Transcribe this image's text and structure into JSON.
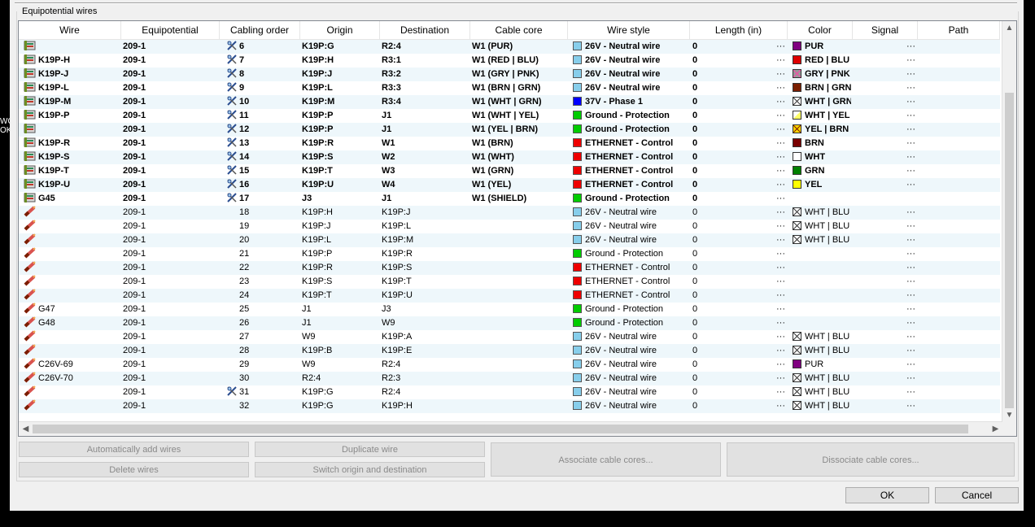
{
  "window": {
    "group_title": "Equipotential wires"
  },
  "columns": [
    {
      "key": "wire",
      "label": "Wire"
    },
    {
      "key": "equip",
      "label": "Equipotential"
    },
    {
      "key": "order",
      "label": "Cabling order"
    },
    {
      "key": "origin",
      "label": "Origin"
    },
    {
      "key": "dest",
      "label": "Destination"
    },
    {
      "key": "core",
      "label": "Cable core"
    },
    {
      "key": "style",
      "label": "Wire style"
    },
    {
      "key": "length",
      "label": "Length (in)"
    },
    {
      "key": "color",
      "label": "Color"
    },
    {
      "key": "signal",
      "label": "Signal"
    },
    {
      "key": "path",
      "label": "Path"
    }
  ],
  "style_colors": {
    "26V - Neutral wire": "#87ceeb",
    "37V - Phase 1": "#0000ff",
    "Ground - Protection": "#00cc00",
    "ETHERNET - Control": "#ee0000"
  },
  "rows": [
    {
      "bold": true,
      "icon": "cable-icon",
      "wire": "",
      "equip": "209-1",
      "oicon": true,
      "order": "6",
      "origin": "K19P:G",
      "dest": "R2:4",
      "core": "W1 (PUR)",
      "style": "26V - Neutral wire",
      "length": "0",
      "dots": "···",
      "color": "PUR",
      "swatch": "#800080",
      "signal": "···",
      "path": ""
    },
    {
      "bold": true,
      "icon": "cable-icon",
      "wire": "K19P-H",
      "equip": "209-1",
      "oicon": true,
      "order": "7",
      "origin": "K19P:H",
      "dest": "R3:1",
      "core": "W1 (RED  |  BLU)",
      "style": "26V - Neutral wire",
      "length": "0",
      "dots": "···",
      "color": "RED  |  BLU",
      "swatch": "#dd0000",
      "signal": "···",
      "path": ""
    },
    {
      "bold": true,
      "icon": "cable-icon",
      "wire": "K19P-J",
      "equip": "209-1",
      "oicon": true,
      "order": "8",
      "origin": "K19P:J",
      "dest": "R3:2",
      "core": "W1 (GRY  |  PNK)",
      "style": "26V - Neutral wire",
      "length": "0",
      "dots": "···",
      "color": "GRY  |  PNK",
      "swatch": "pattern-gray",
      "signal": "···",
      "path": ""
    },
    {
      "bold": true,
      "icon": "cable-icon",
      "wire": "K19P-L",
      "equip": "209-1",
      "oicon": true,
      "order": "9",
      "origin": "K19P:L",
      "dest": "R3:3",
      "core": "W1 (BRN  |  GRN)",
      "style": "26V - Neutral wire",
      "length": "0",
      "dots": "···",
      "color": "BRN  |  GRN",
      "swatch": "#7a1e00",
      "signal": "···",
      "path": ""
    },
    {
      "bold": true,
      "icon": "cable-icon",
      "wire": "K19P-M",
      "equip": "209-1",
      "oicon": true,
      "order": "10",
      "origin": "K19P:M",
      "dest": "R3:4",
      "core": "W1 (WHT  |  GRN)",
      "style": "37V - Phase 1",
      "length": "0",
      "dots": "···",
      "color": "WHT  |  GRN",
      "swatch": "pattern-x",
      "signal": "···",
      "path": ""
    },
    {
      "bold": true,
      "icon": "cable-icon",
      "wire": "K19P-P",
      "equip": "209-1",
      "oicon": true,
      "order": "11",
      "origin": "K19P:P",
      "dest": "J1",
      "core": "W1 (WHT  |  YEL)",
      "style": "Ground - Protection",
      "length": "0",
      "dots": "···",
      "color": "WHT  |  YEL",
      "swatch": "pattern-y",
      "signal": "···",
      "path": ""
    },
    {
      "bold": true,
      "icon": "cable-icon",
      "wire": "",
      "equip": "209-1",
      "oicon": true,
      "order": "12",
      "origin": "K19P:P",
      "dest": "J1",
      "core": "W1 (YEL  |  BRN)",
      "style": "Ground - Protection",
      "length": "0",
      "dots": "···",
      "color": "YEL  |  BRN",
      "swatch": "pattern-yb",
      "signal": "···",
      "path": ""
    },
    {
      "bold": true,
      "icon": "cable-icon",
      "wire": "K19P-R",
      "equip": "209-1",
      "oicon": true,
      "order": "13",
      "origin": "K19P:R",
      "dest": "W1",
      "core": "W1 (BRN)",
      "style": "ETHERNET - Control",
      "length": "0",
      "dots": "···",
      "color": "BRN",
      "swatch": "#7a0000",
      "signal": "···",
      "path": ""
    },
    {
      "bold": true,
      "icon": "cable-icon",
      "wire": "K19P-S",
      "equip": "209-1",
      "oicon": true,
      "order": "14",
      "origin": "K19P:S",
      "dest": "W2",
      "core": "W1 (WHT)",
      "style": "ETHERNET - Control",
      "length": "0",
      "dots": "···",
      "color": "WHT",
      "swatch": "#ffffff",
      "signal": "···",
      "path": ""
    },
    {
      "bold": true,
      "icon": "cable-icon",
      "wire": "K19P-T",
      "equip": "209-1",
      "oicon": true,
      "order": "15",
      "origin": "K19P:T",
      "dest": "W3",
      "core": "W1 (GRN)",
      "style": "ETHERNET - Control",
      "length": "0",
      "dots": "···",
      "color": "GRN",
      "swatch": "#008000",
      "signal": "···",
      "path": ""
    },
    {
      "bold": true,
      "icon": "cable-icon",
      "wire": "K19P-U",
      "equip": "209-1",
      "oicon": true,
      "order": "16",
      "origin": "K19P:U",
      "dest": "W4",
      "core": "W1 (YEL)",
      "style": "ETHERNET - Control",
      "length": "0",
      "dots": "···",
      "color": "YEL",
      "swatch": "#ffff00",
      "signal": "···",
      "path": ""
    },
    {
      "bold": true,
      "icon": "cable-icon",
      "wire": "G45",
      "equip": "209-1",
      "oicon": true,
      "order": "17",
      "origin": "J3",
      "dest": "J1",
      "core": "W1 (SHIELD)",
      "style": "Ground - Protection",
      "length": "0",
      "dots": "···",
      "color": "",
      "swatch": "",
      "signal": "",
      "path": ""
    },
    {
      "bold": false,
      "icon": "wire-icon",
      "wire": "",
      "equip": "209-1",
      "oicon": false,
      "order": "18",
      "origin": "K19P:H",
      "dest": "K19P:J",
      "core": "",
      "style": "26V - Neutral wire",
      "length": "0",
      "dots": "···",
      "color": "WHT  |  BLU",
      "swatch": "pattern-x",
      "signal": "···",
      "path": ""
    },
    {
      "bold": false,
      "icon": "wire-icon",
      "wire": "",
      "equip": "209-1",
      "oicon": false,
      "order": "19",
      "origin": "K19P:J",
      "dest": "K19P:L",
      "core": "",
      "style": "26V - Neutral wire",
      "length": "0",
      "dots": "···",
      "color": "WHT  |  BLU",
      "swatch": "pattern-x",
      "signal": "···",
      "path": ""
    },
    {
      "bold": false,
      "icon": "wire-icon",
      "wire": "",
      "equip": "209-1",
      "oicon": false,
      "order": "20",
      "origin": "K19P:L",
      "dest": "K19P:M",
      "core": "",
      "style": "26V - Neutral wire",
      "length": "0",
      "dots": "···",
      "color": "WHT  |  BLU",
      "swatch": "pattern-x",
      "signal": "···",
      "path": ""
    },
    {
      "bold": false,
      "icon": "wire-icon",
      "wire": "",
      "equip": "209-1",
      "oicon": false,
      "order": "21",
      "origin": "K19P:P",
      "dest": "K19P:R",
      "core": "",
      "style": "Ground - Protection",
      "length": "0",
      "dots": "···",
      "color": "",
      "swatch": "",
      "signal": "···",
      "path": ""
    },
    {
      "bold": false,
      "icon": "wire-icon",
      "wire": "",
      "equip": "209-1",
      "oicon": false,
      "order": "22",
      "origin": "K19P:R",
      "dest": "K19P:S",
      "core": "",
      "style": "ETHERNET - Control",
      "length": "0",
      "dots": "···",
      "color": "",
      "swatch": "",
      "signal": "···",
      "path": ""
    },
    {
      "bold": false,
      "icon": "wire-icon",
      "wire": "",
      "equip": "209-1",
      "oicon": false,
      "order": "23",
      "origin": "K19P:S",
      "dest": "K19P:T",
      "core": "",
      "style": "ETHERNET - Control",
      "length": "0",
      "dots": "···",
      "color": "",
      "swatch": "",
      "signal": "···",
      "path": ""
    },
    {
      "bold": false,
      "icon": "wire-icon",
      "wire": "",
      "equip": "209-1",
      "oicon": false,
      "order": "24",
      "origin": "K19P:T",
      "dest": "K19P:U",
      "core": "",
      "style": "ETHERNET - Control",
      "length": "0",
      "dots": "···",
      "color": "",
      "swatch": "",
      "signal": "···",
      "path": ""
    },
    {
      "bold": false,
      "icon": "wire-icon",
      "wire": "G47",
      "equip": "209-1",
      "oicon": false,
      "order": "25",
      "origin": "J1",
      "dest": "J3",
      "core": "",
      "style": "Ground - Protection",
      "length": "0",
      "dots": "···",
      "color": "",
      "swatch": "",
      "signal": "···",
      "path": ""
    },
    {
      "bold": false,
      "icon": "wire-icon",
      "wire": "G48",
      "equip": "209-1",
      "oicon": false,
      "order": "26",
      "origin": "J1",
      "dest": "W9",
      "core": "",
      "style": "Ground - Protection",
      "length": "0",
      "dots": "···",
      "color": "",
      "swatch": "",
      "signal": "···",
      "path": ""
    },
    {
      "bold": false,
      "icon": "wire-icon",
      "wire": "",
      "equip": "209-1",
      "oicon": false,
      "order": "27",
      "origin": "W9",
      "dest": "K19P:A",
      "core": "",
      "style": "26V - Neutral wire",
      "length": "0",
      "dots": "···",
      "color": "WHT  |  BLU",
      "swatch": "pattern-x",
      "signal": "···",
      "path": ""
    },
    {
      "bold": false,
      "icon": "wire-icon",
      "wire": "",
      "equip": "209-1",
      "oicon": false,
      "order": "28",
      "origin": "K19P:B",
      "dest": "K19P:E",
      "core": "",
      "style": "26V - Neutral wire",
      "length": "0",
      "dots": "···",
      "color": "WHT  |  BLU",
      "swatch": "pattern-x",
      "signal": "···",
      "path": ""
    },
    {
      "bold": false,
      "icon": "wire-icon",
      "wire": "C26V-69",
      "equip": "209-1",
      "oicon": false,
      "order": "29",
      "origin": "W9",
      "dest": "R2:4",
      "core": "",
      "style": "26V - Neutral wire",
      "length": "0",
      "dots": "···",
      "color": "PUR",
      "swatch": "#800080",
      "signal": "···",
      "path": ""
    },
    {
      "bold": false,
      "icon": "wire-icon",
      "wire": "C26V-70",
      "equip": "209-1",
      "oicon": false,
      "order": "30",
      "origin": "R2:4",
      "dest": "R2:3",
      "core": "",
      "style": "26V - Neutral wire",
      "length": "0",
      "dots": "···",
      "color": "WHT  |  BLU",
      "swatch": "pattern-x",
      "signal": "···",
      "path": ""
    },
    {
      "bold": false,
      "icon": "wire-icon",
      "wire": "",
      "equip": "209-1",
      "oicon": true,
      "order": "31",
      "origin": "K19P:G",
      "dest": "R2:4",
      "core": "",
      "style": "26V - Neutral wire",
      "length": "0",
      "dots": "···",
      "color": "WHT  |  BLU",
      "swatch": "pattern-x",
      "signal": "···",
      "path": ""
    },
    {
      "bold": false,
      "icon": "wire-icon",
      "wire": "",
      "equip": "209-1",
      "oicon": false,
      "order": "32",
      "origin": "K19P:G",
      "dest": "K19P:H",
      "core": "",
      "style": "26V - Neutral wire",
      "length": "0",
      "dots": "···",
      "color": "WHT  |  BLU",
      "swatch": "pattern-x",
      "signal": "···",
      "path": ""
    }
  ],
  "buttons": {
    "auto_add": "Automatically add wires",
    "duplicate": "Duplicate wire",
    "delete": "Delete wires",
    "switch": "Switch origin and destination",
    "associate": "Associate cable cores...",
    "dissociate": "Dissociate cable cores...",
    "ok": "OK",
    "cancel": "Cancel"
  },
  "left_fragment": {
    "line1": "WO",
    "line2": "OK"
  }
}
